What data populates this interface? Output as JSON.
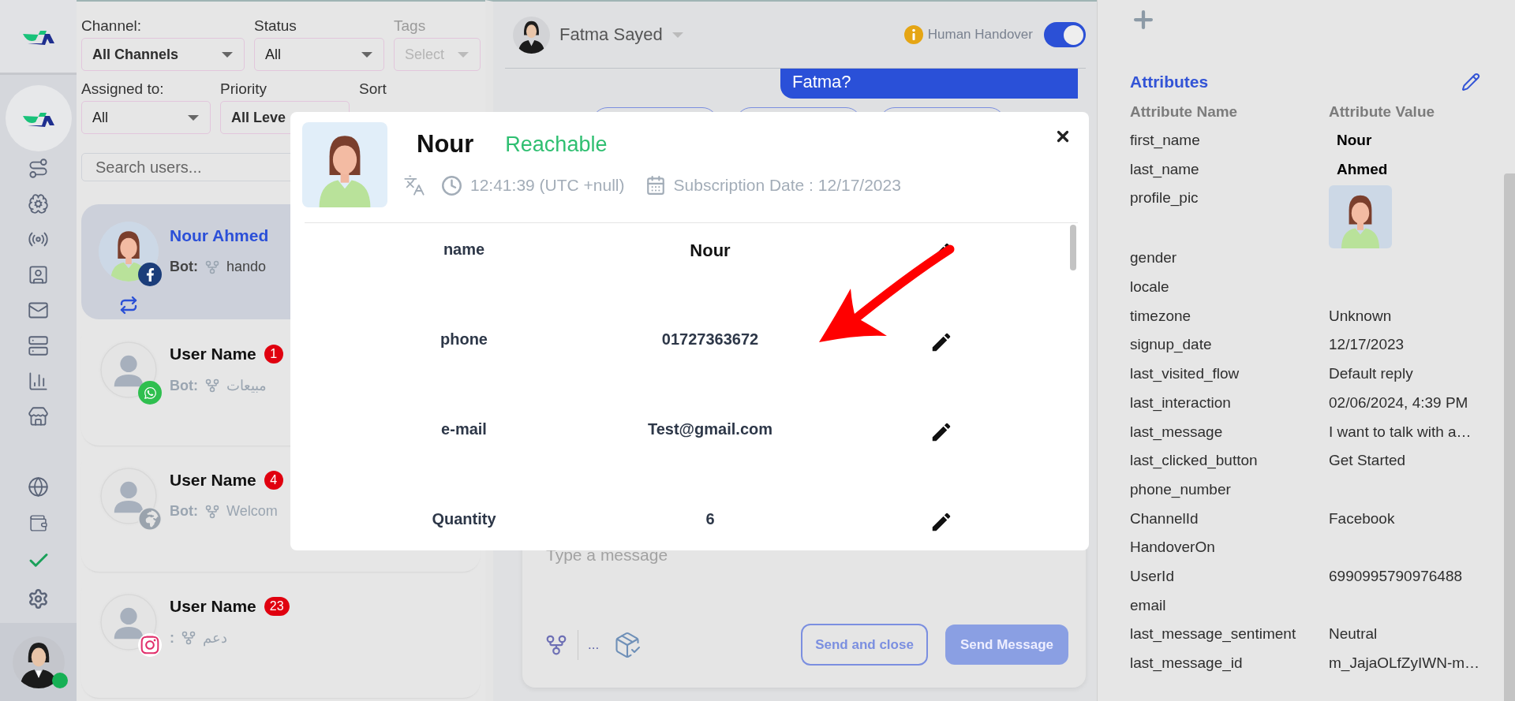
{
  "filter_rows": [
    [
      {
        "label": "Channel:",
        "value": "All Channels",
        "emphasis": true,
        "disabled": false
      },
      {
        "label": "Status",
        "value": "All",
        "emphasis": false,
        "disabled": false
      },
      {
        "label": "Tags",
        "value": "Select",
        "emphasis": false,
        "disabled": true
      }
    ],
    [
      {
        "label": "Assigned to:",
        "value": "All",
        "emphasis": false,
        "disabled": false
      },
      {
        "label": "Priority",
        "value": "All Leve",
        "emphasis": true,
        "disabled": false
      },
      {
        "label": "Sort"
      }
    ]
  ],
  "search": {
    "placeholder": "Search users..."
  },
  "users": [
    {
      "name": "Nour Ahmed",
      "bot_label": "Bot:",
      "flow": "hando",
      "kind": "facebook",
      "selected": true,
      "transferred": true
    },
    {
      "name": "User Name",
      "badge": "1",
      "bot_label": "Bot:",
      "flow": "مبيعات",
      "kind": "whatsapp",
      "selected": false,
      "transferred": false
    },
    {
      "name": "User Name",
      "badge": "4",
      "bot_label": "Bot:",
      "flow": "Welcom",
      "kind": "web",
      "selected": false,
      "transferred": false
    },
    {
      "name": "User Name",
      "badge": "23",
      "bot_label": ":",
      "flow": "دعم",
      "kind": "instagram",
      "selected": false,
      "transferred": false
    }
  ],
  "agent": {
    "online": true
  },
  "chat": {
    "agent": "Fatma Sayed",
    "handover_label": "Human Handover",
    "handover_on": true,
    "messages": [
      {
        "text": "Fatma?"
      }
    ],
    "input_placeholder": "Type a message",
    "more": "...",
    "buttons": [
      "Send and close",
      "Send Message"
    ]
  },
  "profile_modal": {
    "name": "Nour",
    "status": {
      "label": "Reachable",
      "kind": "reachable"
    },
    "time": "12:41:39 (UTC +null)",
    "subscription": "Subscription Date : 12/17/2023",
    "fields": [
      {
        "label": "name",
        "value": "Nour",
        "kind": "title"
      },
      {
        "label": "phone",
        "value": "01727363672",
        "kind": "text"
      },
      {
        "label": "e-mail",
        "value": "Test@gmail.com",
        "kind": "text"
      },
      {
        "label": "Quantity",
        "value": "6",
        "kind": "text"
      }
    ]
  },
  "attributes": {
    "title": "Attributes",
    "columns": [
      "Attribute Name",
      "Attribute Value"
    ],
    "rows": [
      {
        "name": "first_name",
        "value": "Nour",
        "kind": "bold"
      },
      {
        "name": "last_name",
        "value": "Ahmed",
        "kind": "bold"
      },
      {
        "name": "profile_pic"
      },
      {
        "name": "gender",
        "kind": "text"
      },
      {
        "name": "locale",
        "kind": "text"
      },
      {
        "name": "timezone",
        "value": "Unknown",
        "kind": "text"
      },
      {
        "name": "signup_date",
        "value": "12/17/2023",
        "kind": "text"
      },
      {
        "name": "last_visited_flow",
        "value": "Default reply",
        "kind": "text"
      },
      {
        "name": "last_interaction",
        "value": "02/06/2024, 4:39 PM",
        "kind": "text"
      },
      {
        "name": "last_message",
        "value": "I want to talk with a…",
        "kind": "text"
      },
      {
        "name": "last_clicked_button",
        "value": "Get Started",
        "kind": "text"
      },
      {
        "name": "phone_number",
        "kind": "text"
      },
      {
        "name": "ChannelId",
        "value": "Facebook",
        "kind": "text"
      },
      {
        "name": "HandoverOn",
        "kind": "text"
      },
      {
        "name": "UserId",
        "value": "6990995790976488",
        "kind": "text"
      },
      {
        "name": "email",
        "kind": "text"
      },
      {
        "name": "last_message_sentiment",
        "value": "Neutral",
        "kind": "text"
      },
      {
        "name": "last_message_id",
        "value": "m_JajaOLfZyIWN-m…",
        "kind": "text"
      }
    ]
  }
}
